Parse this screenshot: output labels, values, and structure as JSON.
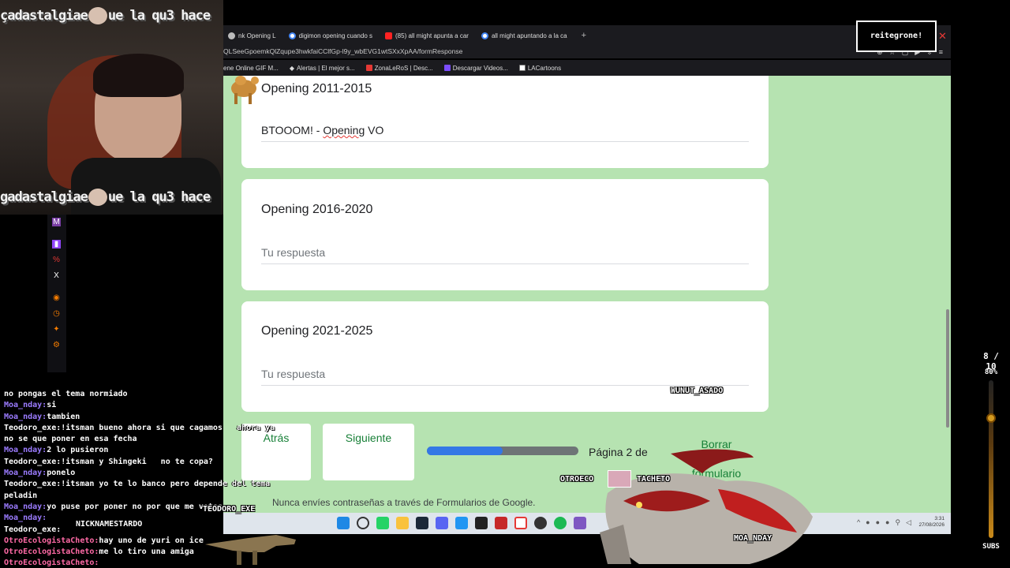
{
  "browser": {
    "tabs": [
      {
        "label": "nk Opening L",
        "favicon": "page-icon"
      },
      {
        "label": "digimon opening cuando s",
        "favicon": "google-icon"
      },
      {
        "label": "(85) all might apunta a car",
        "favicon": "youtube-icon"
      },
      {
        "label": "all might apuntando a la ca",
        "favicon": "google-icon"
      }
    ],
    "new_tab": "+",
    "url": "QLSeeGpoemkQlZqupe3hwkfaiCClfGp-l9y_wbEVG1wtSXxXpAA/formResponse",
    "bookmarks": [
      "ene Online GIF M...",
      "Alertas | El mejor s...",
      "ZonaLeRoS | Desc...",
      "Descargar Videos...",
      "LACartoons"
    ]
  },
  "form": {
    "q1": {
      "title": "Opening 2011-2015",
      "answer_pre": "BTOOOM! - ",
      "answer_squiggle": "Opening",
      "answer_post": " VO"
    },
    "q2": {
      "title": "Opening 2016-2020",
      "placeholder": "Tu respuesta"
    },
    "q3": {
      "title": "Opening 2021-2025",
      "placeholder": "Tu respuesta"
    },
    "back_label": "Atrás",
    "next_label": "Siguiente",
    "page_indicator": "Página 2 de",
    "progress": 0.5,
    "clear_line1": "Borrar",
    "clear_line2": "formulario",
    "footer": "Nunca envíes contraseñas a través de Formularios de Google."
  },
  "taskbar": {
    "time": "3:31",
    "date": "27/08/2026"
  },
  "stream": {
    "banner_top": "çadastalgiae",
    "banner_top_right": "ue la qu3 hace",
    "banner_bottom": "gadastalgiae",
    "banner_bottom_right": "ue la qu3 hace",
    "top_box": "reitegrone!",
    "subs_count": "8 / 10",
    "subs_percent": "80%",
    "subs_label": "SUBS",
    "labels": {
      "wunut": "WUNUT_ASADO",
      "otroeco": "OTROECO",
      "tacheto": "TACHETO",
      "moa": "MOA_NDAY",
      "teodoro": "TEODORO_EXE",
      "nicknamestardo": "NICKNAMESTARDO"
    },
    "chat": [
      {
        "user": "",
        "text": "no pongas el tema normiado",
        "cls": "u2"
      },
      {
        "user": "Moa_nday:",
        "text": "si",
        "cls": "u1"
      },
      {
        "user": "Moa_nday:",
        "text": "tambien",
        "cls": "u1"
      },
      {
        "user": "Teodoro_exe:",
        "text": "!itsman bueno ahora si que cagamos   ahora ya",
        "cls": "u2"
      },
      {
        "user": "",
        "text": "no se que poner en esa fecha",
        "cls": "u2"
      },
      {
        "user": "Moa_nday:",
        "text": "2 lo pusieron",
        "cls": "u1"
      },
      {
        "user": "Teodoro_exe:",
        "text": "!itsman y Shingeki   no te copa?",
        "cls": "u2"
      },
      {
        "user": "Moa_nday:",
        "text": "ponelo",
        "cls": "u1"
      },
      {
        "user": "Teodoro_exe:",
        "text": "!itsman yo te lo banco pero depende del tema",
        "cls": "u2"
      },
      {
        "user": "",
        "text": "peladin",
        "cls": "u2"
      },
      {
        "user": "Moa_nday:",
        "text": "yo puse por poner no por que me votes",
        "cls": "u1"
      },
      {
        "user": "Moa_nday:",
        "text": "",
        "cls": "u1"
      },
      {
        "user": "Teodoro_exe:",
        "text": "",
        "cls": "u2"
      },
      {
        "user": "OtroEcologistaCheto:",
        "text": "hay uno de yuri on ice",
        "cls": "u3"
      },
      {
        "user": "OtroEcologistaCheto:",
        "text": "me lo tiro una amiga",
        "cls": "u3"
      },
      {
        "user": "OtroEcologistaCheto:",
        "text": "",
        "cls": "u3"
      }
    ]
  }
}
